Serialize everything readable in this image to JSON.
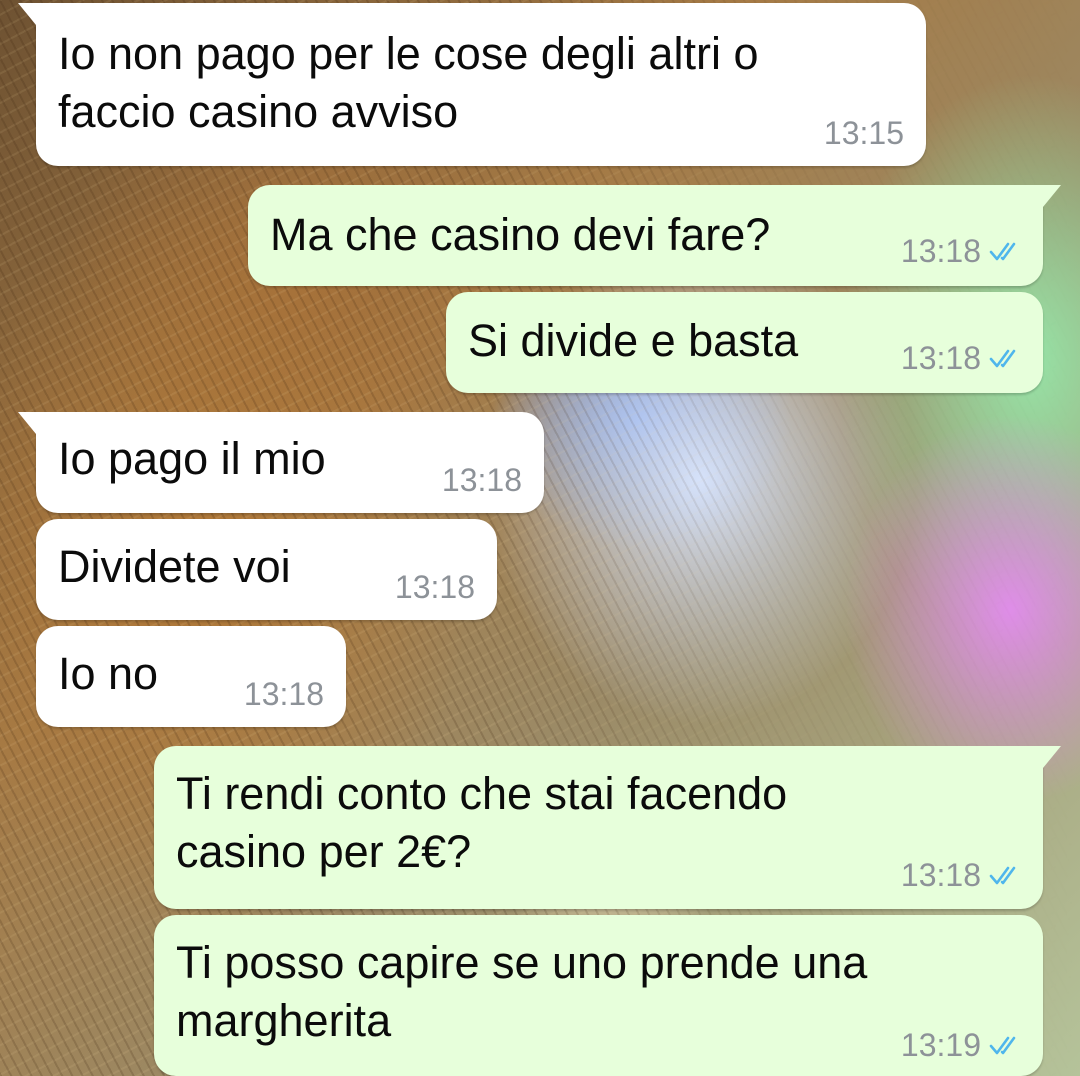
{
  "chat": {
    "messages": [
      {
        "direction": "in",
        "text": "Io non pago per le cose degli altri o\nfaccio casino avviso",
        "time": "13:15"
      },
      {
        "direction": "out",
        "text": "Ma che casino devi fare?",
        "time": "13:18",
        "status": "read"
      },
      {
        "direction": "out",
        "text": "Si divide e basta",
        "time": "13:18",
        "status": "read"
      },
      {
        "direction": "in",
        "text": "Io pago il mio",
        "time": "13:18"
      },
      {
        "direction": "in",
        "text": "Dividete voi",
        "time": "13:18"
      },
      {
        "direction": "in",
        "text": "Io no",
        "time": "13:18"
      },
      {
        "direction": "out",
        "text": "Ti rendi conto che stai facendo\ncasino per 2€?",
        "time": "13:18",
        "status": "read"
      },
      {
        "direction": "out",
        "text": "Ti posso capire se uno prende una\nmargherita",
        "time": "13:19",
        "status": "read"
      }
    ]
  },
  "colors": {
    "incoming_bubble": "#ffffff",
    "outgoing_bubble": "#e7ffdb",
    "timestamp": "#8d9298",
    "read_ticks": "#4fb6ec"
  },
  "icons": {
    "read_status": "double-check-icon"
  }
}
